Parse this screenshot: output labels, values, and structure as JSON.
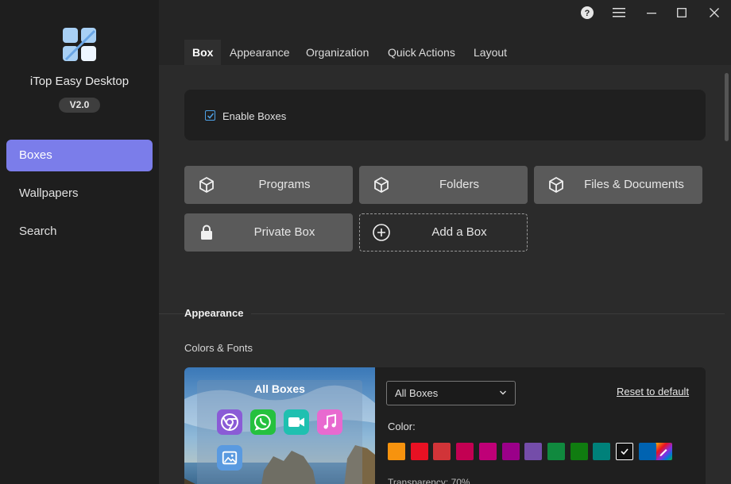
{
  "app": {
    "title": "iTop Easy Desktop",
    "version": "V2.0"
  },
  "sidebar": {
    "items": [
      {
        "label": "Boxes",
        "active": true
      },
      {
        "label": "Wallpapers",
        "active": false
      },
      {
        "label": "Search",
        "active": false
      }
    ]
  },
  "window_controls": [
    "help-icon",
    "menu-icon",
    "minimize-icon",
    "maximize-icon",
    "close-icon"
  ],
  "tabs": [
    {
      "label": "Box",
      "active": true
    },
    {
      "label": "Appearance",
      "active": false
    },
    {
      "label": "Organization",
      "active": false
    },
    {
      "label": "Quick Actions",
      "active": false
    },
    {
      "label": "Layout",
      "active": false
    }
  ],
  "box_tab": {
    "enable_boxes": {
      "label": "Enable Boxes",
      "checked": true
    },
    "boxes": [
      {
        "label": "Programs",
        "icon": "cube-icon"
      },
      {
        "label": "Folders",
        "icon": "cube-icon"
      },
      {
        "label": "Files & Documents",
        "icon": "cube-icon"
      },
      {
        "label": "Private Box",
        "icon": "lock-icon"
      },
      {
        "label": "Add a Box",
        "icon": "plus-circle-icon"
      }
    ]
  },
  "appearance": {
    "heading": "Appearance",
    "colors_fonts_label": "Colors & Fonts",
    "preview": {
      "title": "All Boxes",
      "icons": [
        "chrome-icon",
        "whatsapp-icon",
        "video-icon",
        "music-icon",
        "image-icon"
      ]
    },
    "box_selector": {
      "value": "All Boxes"
    },
    "reset_label": "Reset to default",
    "color_label": "Color:",
    "colors": [
      "#f7930e",
      "#e81123",
      "#d13438",
      "#c30052",
      "#bf0077",
      "#9a0089",
      "#744da9",
      "#10893e",
      "#107c10",
      "#00817a",
      "#111111",
      "#0063b1"
    ],
    "selected_color": "#111111",
    "transparency_label": "Transparency: 70%"
  },
  "colors": {
    "accent": "#7b7dea",
    "sidebar_bg": "#1e1e1e",
    "main_bg": "#2b2b2b",
    "card_bg": "#1f1f1f",
    "button_bg": "#5a5a5a"
  }
}
